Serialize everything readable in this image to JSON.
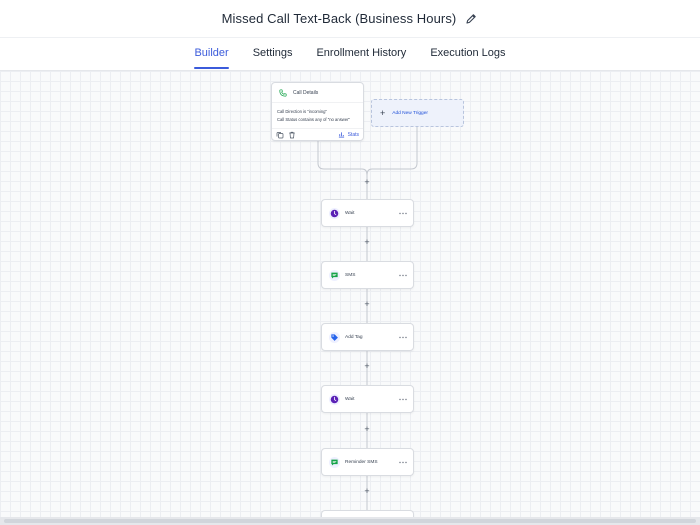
{
  "header": {
    "title": "Missed Call Text-Back (Business Hours)",
    "edit_icon": "pencil-icon"
  },
  "tabs": [
    {
      "label": "Builder",
      "active": true
    },
    {
      "label": "Settings",
      "active": false
    },
    {
      "label": "Enrollment History",
      "active": false
    },
    {
      "label": "Execution Logs",
      "active": false
    }
  ],
  "trigger": {
    "icon": "phone-icon",
    "title": "Call Details",
    "conditions": [
      "Call Direction is \"incoming\"",
      "Call Status contains any of \"no answer\""
    ],
    "footer_icons": [
      "copy-icon",
      "trash-icon"
    ],
    "stats_icon": "bar-chart-icon",
    "stats_label": "Stats"
  },
  "add_trigger": {
    "icon": "plus-icon",
    "label": "Add New Trigger"
  },
  "actions": [
    {
      "label": "Wait",
      "icon": "clock-icon",
      "color": "#5b21b6"
    },
    {
      "label": "SMS",
      "icon": "message-icon",
      "color": "#16a34a"
    },
    {
      "label": "Add Tag",
      "icon": "tag-icon",
      "color": "#2563eb"
    },
    {
      "label": "Wait",
      "icon": "clock-icon",
      "color": "#5b21b6"
    },
    {
      "label": "Reminder SMS",
      "icon": "message-icon",
      "color": "#16a34a"
    }
  ],
  "add_step_glyph": "+",
  "colors": {
    "accent": "#3b5bdb",
    "canvas": "#f9fafb"
  }
}
